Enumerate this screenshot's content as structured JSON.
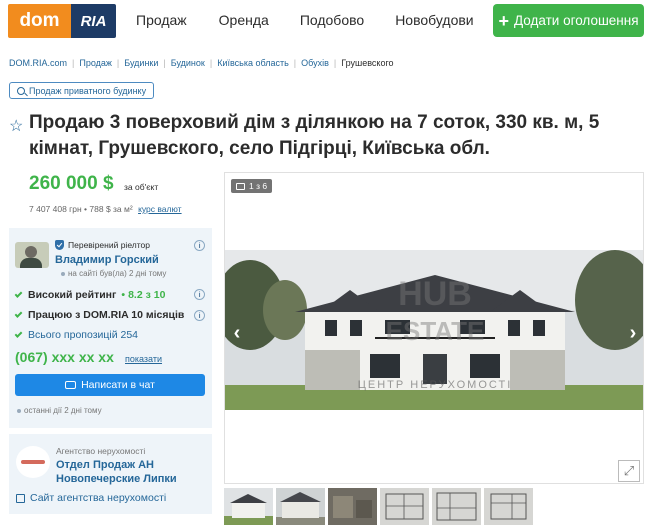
{
  "header": {
    "logo_dom": "dom",
    "logo_ria": "RIA",
    "nav": [
      "Продаж",
      "Оренда",
      "Подобово",
      "Новобудови"
    ],
    "add_button": "Додати оголошення",
    "brand_color": "#3fb44a"
  },
  "breadcrumb": [
    "DOM.RIA.com",
    "Продаж",
    "Будинки",
    "Будинок",
    "Київська область",
    "Обухів",
    "Грушевского"
  ],
  "search_chip": "Продаж приватного будинку",
  "title": "Продаю 3 поверховий дім з ділянкою на 7 соток, 330 кв. м, 5 кімнат, Грушевского, село Підгірці, Київська обл.",
  "price": {
    "main": "260 000 $",
    "unit": "за об'єкт",
    "secondary": "7 407 408 грн • 788 $ за м²",
    "rate_link": "курс валют"
  },
  "seller": {
    "verified": "Перевірений ріелтор",
    "name": "Владимир Горский",
    "online": "на сайті був(ла) 2 дні тому",
    "rating_label": "Високий рейтинг",
    "rating_value": "8.2 з 10",
    "works_label": "Працюю з DOM.RIA 10 місяців",
    "offers_link": "Всього пропозицій 254",
    "phone": "(067) xxx xx xx",
    "phone_show": "показати",
    "chat_button": "Написати в чат",
    "last_seen": "останні дії 2 дні тому"
  },
  "agency": {
    "type": "Агентство нерухомості",
    "name": "Отдел Продаж АН Новопечерские Липки",
    "site_link": "Сайт агентства нерухомості"
  },
  "gallery": {
    "counter": "1 з 6",
    "watermark_top": "HUB",
    "watermark_mid": "ESTATE",
    "watermark_bottom": "ЦЕНТР НЕРУХОМОСТІ",
    "prev": "‹",
    "next": "›",
    "expand": "⤢"
  }
}
